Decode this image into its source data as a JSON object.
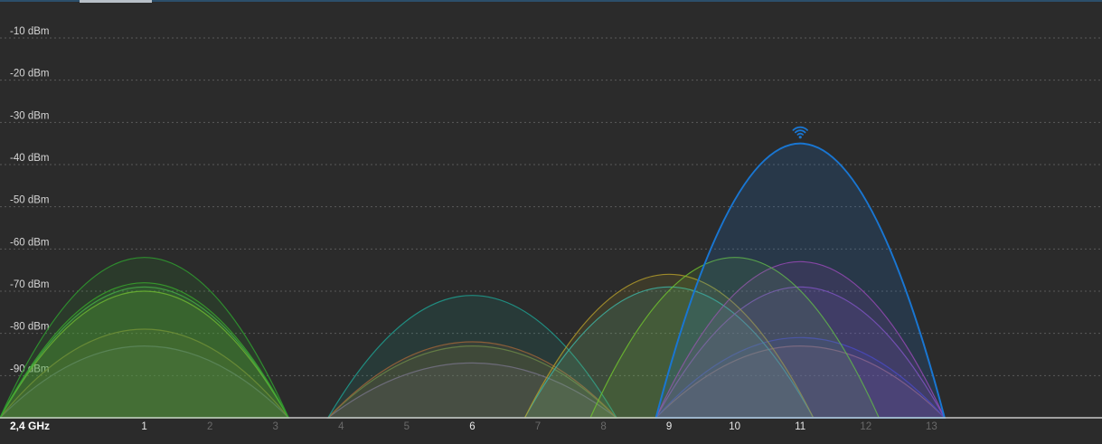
{
  "window": {
    "title": ""
  },
  "chart_data": {
    "type": "area",
    "band_label": "2,4 GHz",
    "y_axis": {
      "unit": "dBm",
      "tick_labels": [
        "-10 dBm",
        "-20 dBm",
        "-30 dBm",
        "-40 dBm",
        "-50 dBm",
        "-60 dBm",
        "-70 dBm",
        "-80 dBm",
        "-90 dBm"
      ],
      "ticks": [
        -10,
        -20,
        -30,
        -40,
        -50,
        -60,
        -70,
        -80,
        -90
      ],
      "range": [
        -100,
        -1
      ],
      "grid": true
    },
    "x_axis": {
      "labels": [
        "1",
        "2",
        "3",
        "4",
        "5",
        "6",
        "7",
        "8",
        "9",
        "10",
        "11",
        "12",
        "13"
      ],
      "channels": [
        1,
        2,
        3,
        4,
        5,
        6,
        7,
        8,
        9,
        10,
        11,
        12,
        13
      ],
      "highlighted": [
        1,
        6,
        9,
        10,
        11
      ],
      "range": [
        -1.2,
        15.6
      ]
    },
    "connected_icon": "wifi-signal-icon",
    "series": [
      {
        "channel": 1,
        "half_width": 2.2,
        "peak_dbm": -62,
        "color": "#2f9e2f"
      },
      {
        "channel": 1,
        "half_width": 2.2,
        "peak_dbm": -68,
        "color": "#3aa82a"
      },
      {
        "channel": 1,
        "half_width": 2.2,
        "peak_dbm": -69,
        "color": "#4caf50"
      },
      {
        "channel": 1,
        "half_width": 2.2,
        "peak_dbm": -70,
        "color": "#8bbf2f"
      },
      {
        "channel": 1,
        "half_width": 2.2,
        "peak_dbm": -79,
        "color": "#8f7a3a"
      },
      {
        "channel": 1,
        "half_width": 2.2,
        "peak_dbm": -83,
        "color": "#6a6a8a"
      },
      {
        "channel": 6,
        "half_width": 2.2,
        "peak_dbm": -71,
        "color": "#1f9e8f"
      },
      {
        "channel": 6,
        "half_width": 2.2,
        "peak_dbm": -82,
        "color": "#b05a2a"
      },
      {
        "channel": 6,
        "half_width": 2.2,
        "peak_dbm": -83,
        "color": "#6f8a3f"
      },
      {
        "channel": 6,
        "half_width": 2.2,
        "peak_dbm": -87,
        "color": "#7f6a9f"
      },
      {
        "channel": 9,
        "half_width": 2.2,
        "peak_dbm": -66,
        "color": "#b09a2a"
      },
      {
        "channel": 9,
        "half_width": 2.2,
        "peak_dbm": -69,
        "color": "#2ab5b5"
      },
      {
        "channel": 10,
        "half_width": 2.2,
        "peak_dbm": -62,
        "color": "#6fbf2f"
      },
      {
        "channel": 11,
        "half_width": 2.2,
        "peak_dbm": -35,
        "color": "#1976d2",
        "connected": true
      },
      {
        "channel": 11,
        "half_width": 2.2,
        "peak_dbm": -63,
        "color": "#b03fae"
      },
      {
        "channel": 11,
        "half_width": 2.2,
        "peak_dbm": -69,
        "color": "#8f4fbf"
      },
      {
        "channel": 11,
        "half_width": 2.2,
        "peak_dbm": -81,
        "color": "#3a3fbf"
      },
      {
        "channel": 11,
        "half_width": 2.2,
        "peak_dbm": -83,
        "color": "#b0705a"
      }
    ]
  }
}
